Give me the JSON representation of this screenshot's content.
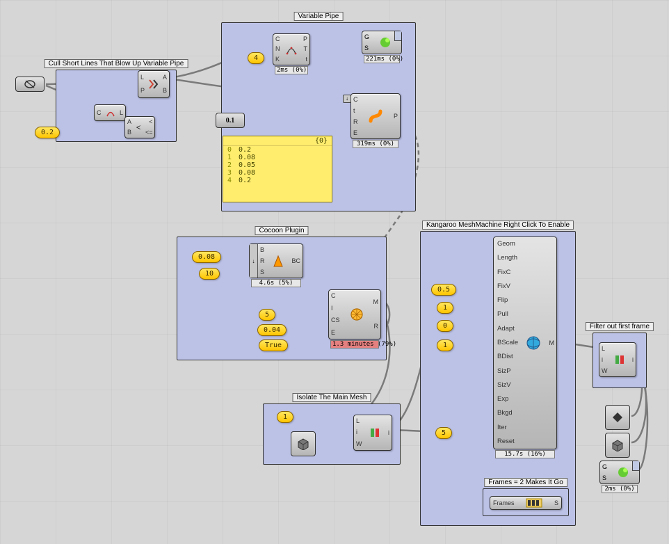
{
  "groups": {
    "cull": {
      "label": "Cull Short Lines That Blow Up Variable Pipe"
    },
    "varpipe": {
      "label": "Variable Pipe"
    },
    "cocoon": {
      "label": "Cocoon Plugin"
    },
    "isolate": {
      "label": "Isolate The Main Mesh"
    },
    "kangaroo": {
      "label": "Kangaroo MeshMachine Right Click To Enable"
    },
    "filterframe": {
      "label": "Filter out first frame"
    },
    "frames2": {
      "label": "Frames = 2 Makes It Go"
    }
  },
  "params": {
    "p0_2_a": "0.2",
    "p4": "4",
    "p0_08": "0.08",
    "p10": "10",
    "p5a": "5",
    "p0_04": "0.04",
    "pTrue": "True",
    "p1_iso": "1",
    "p0_5": "0.5",
    "p1_k": "1",
    "p0_k": "0",
    "p1_k2": "1",
    "p5_k": "5",
    "p_frames": "Frames",
    "p_frames_s": "S"
  },
  "slider": {
    "val": "0.1"
  },
  "nodes": {
    "shatter": {
      "in": [
        "L",
        "P"
      ],
      "out": [
        "A",
        "B"
      ],
      "timing": ""
    },
    "curvelen": {
      "in": [
        "C"
      ],
      "out": [
        "L"
      ]
    },
    "larger": {
      "in": [
        "A",
        "B"
      ],
      "out": [
        "<",
        "<="
      ]
    },
    "pipe": {
      "in": [
        "C",
        "N",
        "K"
      ],
      "out": [
        "P",
        "T",
        "t"
      ],
      "timing": "2ms (0%)"
    },
    "piper": {
      "in": [
        "C",
        "t",
        "R",
        "E"
      ],
      "out": [
        "P"
      ],
      "timing": "319ms (0%)"
    },
    "gs1": {
      "g": "G",
      "s": "S",
      "timing": "221ms (0%)"
    },
    "cocoon1": {
      "in": [
        "B",
        "R",
        "S"
      ],
      "out": [
        "BC"
      ],
      "timing": "4.6s (5%)"
    },
    "cocoon2": {
      "in": [
        "C",
        "I",
        "CS",
        "E"
      ],
      "out": [
        "M",
        "R"
      ],
      "timing": "1.3 minutes (79%)"
    },
    "listitem": {
      "in": [
        "L",
        "i",
        "W"
      ],
      "out": [
        "i"
      ]
    },
    "listitem2": {
      "in": [
        "L",
        "i",
        "W"
      ],
      "out": [
        "i"
      ]
    },
    "kangaroo_inputs": [
      "Geom",
      "Length",
      "FixC",
      "FixV",
      "Flip",
      "Pull",
      "Adapt",
      "BScale",
      "BDist",
      "SizP",
      "SizV",
      "Exp",
      "Bkgd",
      "Iter",
      "Reset"
    ],
    "kangaroo_out": "M",
    "kangaroo_timing": "15.7s (16%)",
    "gs2": {
      "g": "G",
      "s": "S",
      "timing": "2ms (0%)"
    }
  },
  "panel": {
    "header": "{0}",
    "rows": [
      {
        "idx": "0",
        "val": "0.2"
      },
      {
        "idx": "1",
        "val": "0.08"
      },
      {
        "idx": "2",
        "val": "0.05"
      },
      {
        "idx": "3",
        "val": "0.08"
      },
      {
        "idx": "4",
        "val": "0.2"
      }
    ]
  },
  "chart_data": {
    "type": "table",
    "title": "Variable Pipe radii list",
    "categories": [
      0,
      1,
      2,
      3,
      4
    ],
    "values": [
      0.2,
      0.08,
      0.05,
      0.08,
      0.2
    ]
  }
}
